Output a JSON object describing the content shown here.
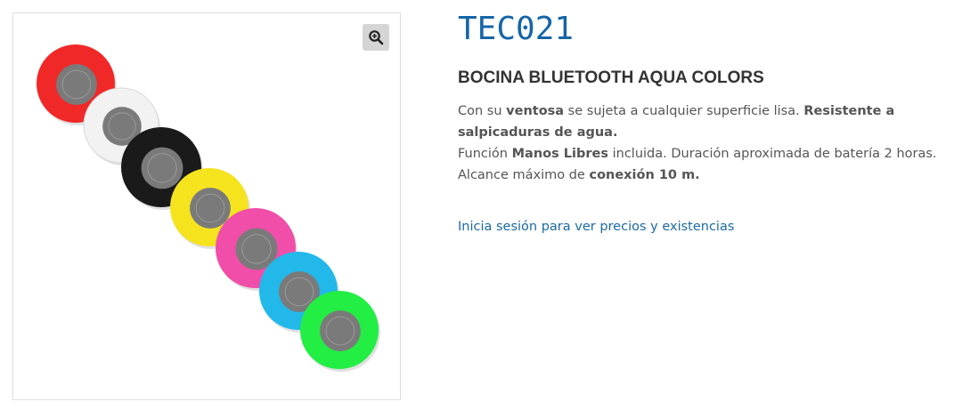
{
  "gallery": {
    "image_alt": "Bocina Bluetooth Aqua Colors",
    "zoom_icon": "zoom-in-icon",
    "speaker_colors": [
      "#f02828",
      "#f2f2f2",
      "#1a1a1a",
      "#f5e31e",
      "#f04ea8",
      "#22b8ea",
      "#22ee44"
    ],
    "grill_color": "#7a7a7a"
  },
  "product": {
    "sku": "TEC021",
    "title": "BOCINA BLUETOOTH AQUA COLORS",
    "description": {
      "line1": {
        "t1": "Con su ",
        "b1": "ventosa",
        "t2": " se sujeta a cualquier superficie lisa. ",
        "b2": "Resistente a salpicaduras de agua."
      },
      "line2": {
        "t1": "Función ",
        "b1": "Manos Libres",
        "t2": " incluida. Duración aproximada de batería 2 horas.",
        "t3": "Alcance máximo de ",
        "b2": "conexión 10 m."
      }
    },
    "login_link": "Inicia sesión para ver precios y existencias"
  }
}
